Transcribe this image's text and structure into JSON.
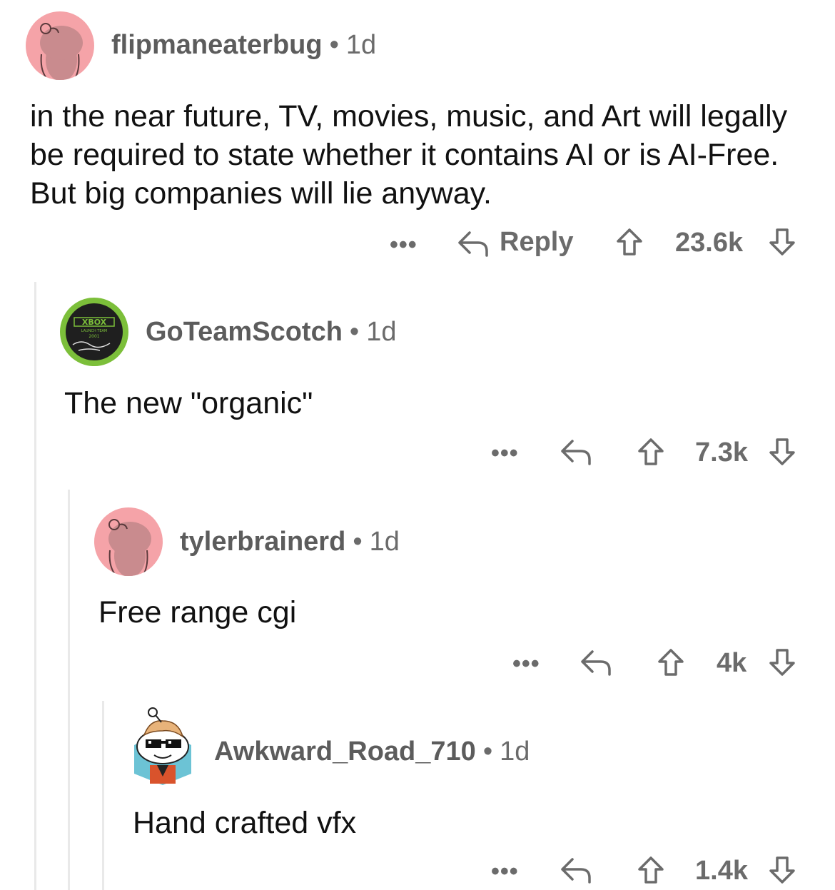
{
  "comments": [
    {
      "username": "flipmaneaterbug",
      "age": "1d",
      "body": "in the near future, TV, movies, music, and Art will legally be required to state whether it contains AI or is AI-Free. But big companies will lie anyway.",
      "reply_label": "Reply",
      "score": "23.6k",
      "more_label": "•••",
      "avatar": "pink-snoo-avatar"
    },
    {
      "username": "GoTeamScotch",
      "age": "1d",
      "body": "The new \"organic\"",
      "score": "7.3k",
      "more_label": "•••",
      "avatar": "xbox-badge-avatar",
      "avatar_text": {
        "brand": "XBOX",
        "line1": "LAUNCH TEAM",
        "line2": "2001"
      }
    },
    {
      "username": "tylerbrainerd",
      "age": "1d",
      "body": "Free range cgi",
      "score": "4k",
      "more_label": "•••",
      "avatar": "pink-snoo-avatar"
    },
    {
      "username": "Awkward_Road_710",
      "age": "1d",
      "body": "Hand crafted vfx",
      "score": "1.4k",
      "more_label": "•••",
      "avatar": "sunglasses-snoo-avatar"
    }
  ],
  "separator": "•",
  "colors": {
    "muted": "#6b6b6b",
    "thread_line": "#e9e9e9",
    "pink_avatar": "#f5a3a8",
    "xbox_green": "#7cbf3a"
  }
}
